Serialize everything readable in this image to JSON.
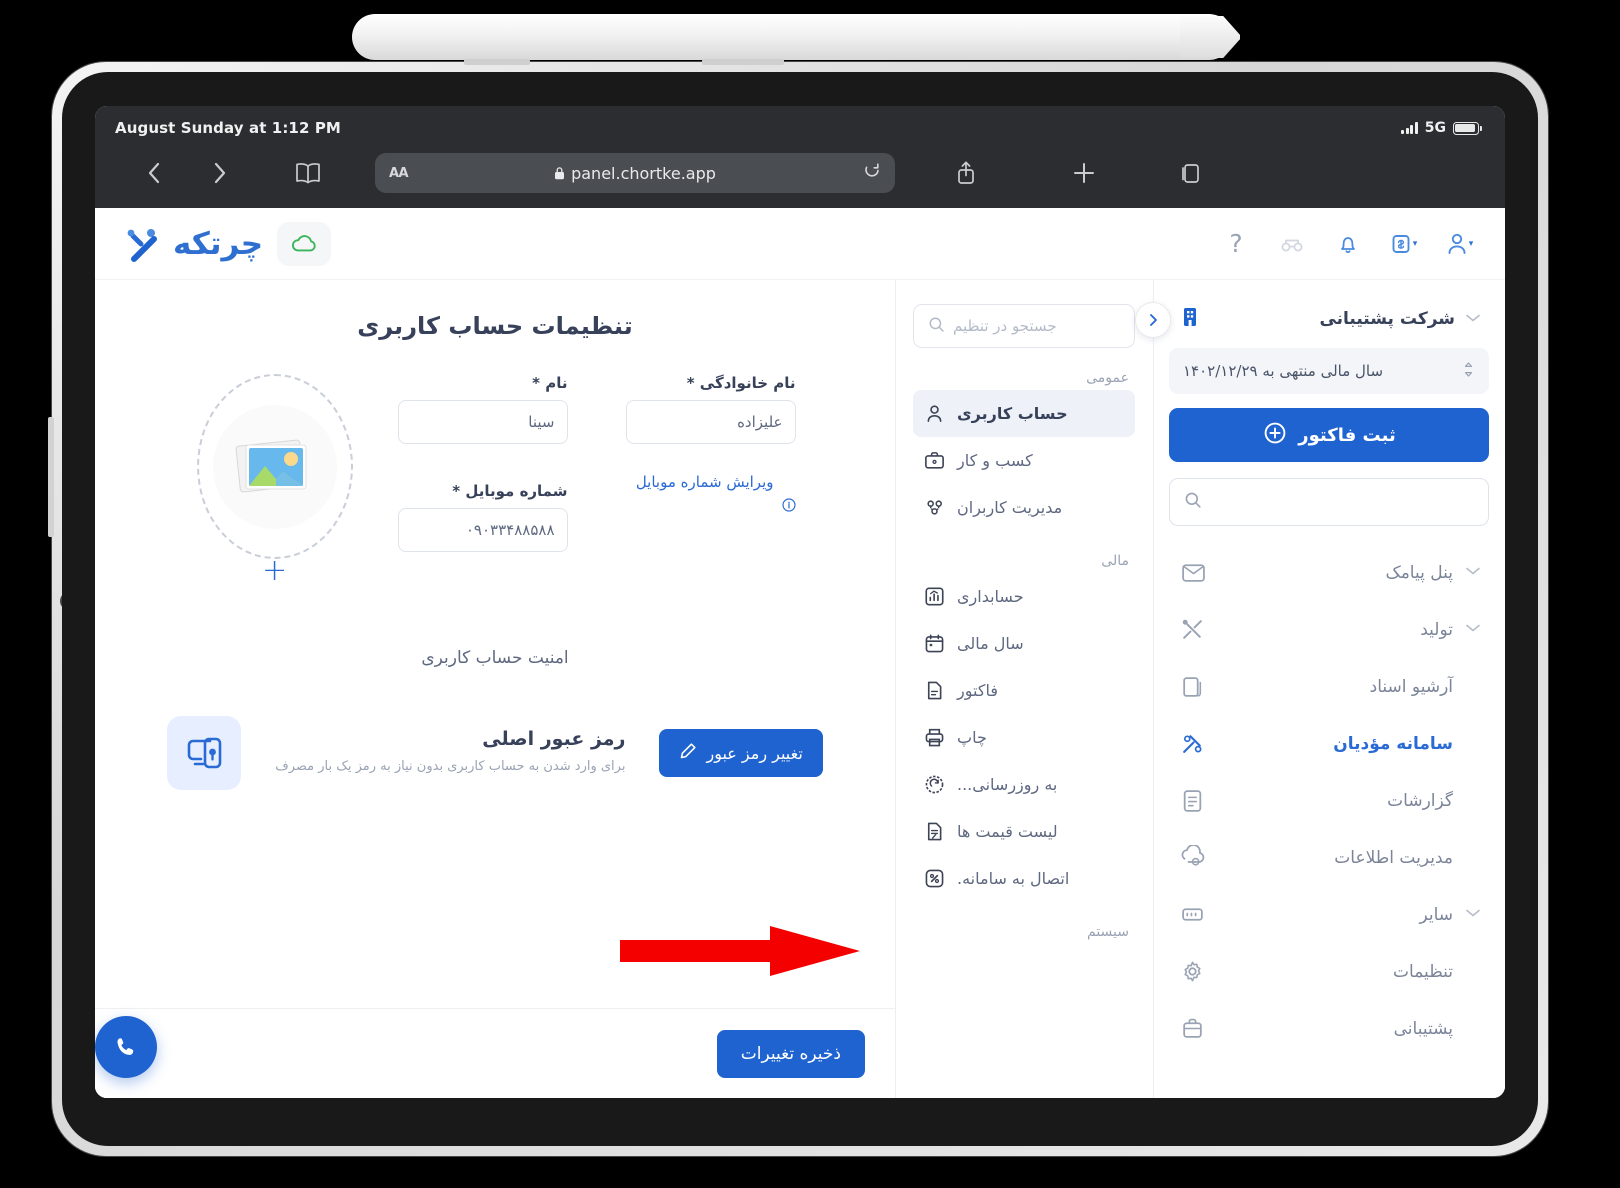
{
  "device": {
    "stylus": "apple-pencil",
    "frame": "ipad"
  },
  "ios_status": {
    "time": "August Sunday at 1:12 PM",
    "network": "5G"
  },
  "browser": {
    "back_icon": "chevron-left-icon",
    "forward_icon": "chevron-right-icon",
    "bookmarks_icon": "book-icon",
    "aa_label": "AA",
    "lock_icon": "lock-icon",
    "url": "panel.chortke.app",
    "reload_icon": "reload-icon",
    "share_icon": "share-icon",
    "new_tab_icon": "plus-icon",
    "tabs_icon": "tabs-icon"
  },
  "appbar": {
    "icons": [
      {
        "name": "user-dropdown-icon",
        "caret": "▾"
      },
      {
        "name": "currency-dropdown-icon",
        "caret": "▾"
      },
      {
        "name": "bell-icon",
        "caret": ""
      },
      {
        "name": "glasses-icon",
        "caret": ""
      },
      {
        "name": "help-icon",
        "caret": ""
      }
    ],
    "help_glyph": "?",
    "cloud_icon": "cloud-icon",
    "brand_name": "چرتکه"
  },
  "sidebar": {
    "company": "شرکت پشتیبانی",
    "company_icon": "building-icon",
    "fiscal_year": "سال مالی منتهی به ۱۴۰۲/۱۲/۲۹",
    "invoice_button": "ثبت فاکتور",
    "invoice_icon": "plus-circle-icon",
    "search_placeholder": "",
    "search_value": "",
    "search_icon": "search-icon",
    "collapse_icon": "chevron-right-icon",
    "items": [
      {
        "label": "پنل پیامک",
        "icon": "sms-icon",
        "expandable": true,
        "active": false
      },
      {
        "label": "تولید",
        "icon": "tools-icon",
        "expandable": true,
        "active": false
      },
      {
        "label": "آرشیو اسناد",
        "icon": "archive-icon",
        "expandable": false,
        "active": false
      },
      {
        "label": "سامانه مؤدیان",
        "icon": "tax-system-icon",
        "expandable": false,
        "active": true
      },
      {
        "label": "گزارشات",
        "icon": "reports-icon",
        "expandable": false,
        "active": false
      },
      {
        "label": "مدیریت اطلاعات",
        "icon": "data-management-icon",
        "expandable": false,
        "active": false
      },
      {
        "label": "سایر",
        "icon": "other-icon",
        "expandable": true,
        "active": false
      },
      {
        "label": "تنظیمات",
        "icon": "gear-icon",
        "expandable": false,
        "active": false
      },
      {
        "label": "پشتیبانی",
        "icon": "support-icon",
        "expandable": false,
        "active": false
      }
    ]
  },
  "midnav": {
    "search_placeholder": "جستجو در تنظیم",
    "search_icon": "search-icon",
    "groups": [
      {
        "title": "عمومی",
        "items": [
          {
            "label": "حساب کاربری",
            "icon": "user-icon",
            "active": true
          },
          {
            "label": "کسب و کار",
            "icon": "briefcase-icon",
            "active": false
          },
          {
            "label": "مدیریت کاربران",
            "icon": "users-icon",
            "active": false
          }
        ]
      },
      {
        "title": "مالی",
        "items": [
          {
            "label": "حسابداری",
            "icon": "accounting-icon",
            "active": false
          },
          {
            "label": "سال مالی",
            "icon": "calendar-icon",
            "active": false
          },
          {
            "label": "فاکتور",
            "icon": "invoice-icon",
            "active": false
          },
          {
            "label": "چاپ",
            "icon": "printer-icon",
            "active": false
          },
          {
            "label": "به روزرسانی...",
            "icon": "refresh-icon",
            "active": false
          },
          {
            "label": "لیست قیمت ها",
            "icon": "price-list-icon",
            "active": false
          },
          {
            "label": "اتصال به سامانه.",
            "icon": "percent-connect-icon",
            "active": false
          }
        ]
      },
      {
        "title": "سیستم",
        "items": []
      }
    ]
  },
  "main": {
    "title": "تنظیمات حساب کاربری",
    "avatar": {
      "icon": "image-placeholder-icon",
      "add_icon": "plus-icon"
    },
    "fields": [
      {
        "label": "نام خانوادگی *",
        "value": "علیزاده",
        "name": "last-name"
      },
      {
        "label": "نام *",
        "value": "سینا",
        "name": "first-name"
      },
      {
        "label": "شماره موبایل *",
        "value": "۰۹۰۳۳۴۸۸۵۸۸",
        "name": "mobile-number"
      }
    ],
    "edit_mobile_link": "ویرایش شماره موبایل",
    "edit_mobile_info_icon": "info-icon",
    "security_section_title": "امنیت حساب کاربری",
    "password": {
      "icon": "password-device-icon",
      "title": "رمز عبور اصلی",
      "description": "برای وارد شدن به حساب کاربری بدون نیاز به رمز یک بار مصرف",
      "button": "تغییر رمز عبور",
      "button_icon": "pencil-icon"
    },
    "save_button": "ذخیره تغییرات",
    "call_fab_icon": "phone-icon"
  },
  "annotation": {
    "arrow_color": "#f50000",
    "points_to": "اتصال به سامانه."
  },
  "colors": {
    "primary": "#1f63d0",
    "accent_link": "#2a6ad4",
    "chrome_bg": "#2b2d30",
    "muted_text": "#9aa3b4",
    "arrow_red": "#f50000"
  }
}
